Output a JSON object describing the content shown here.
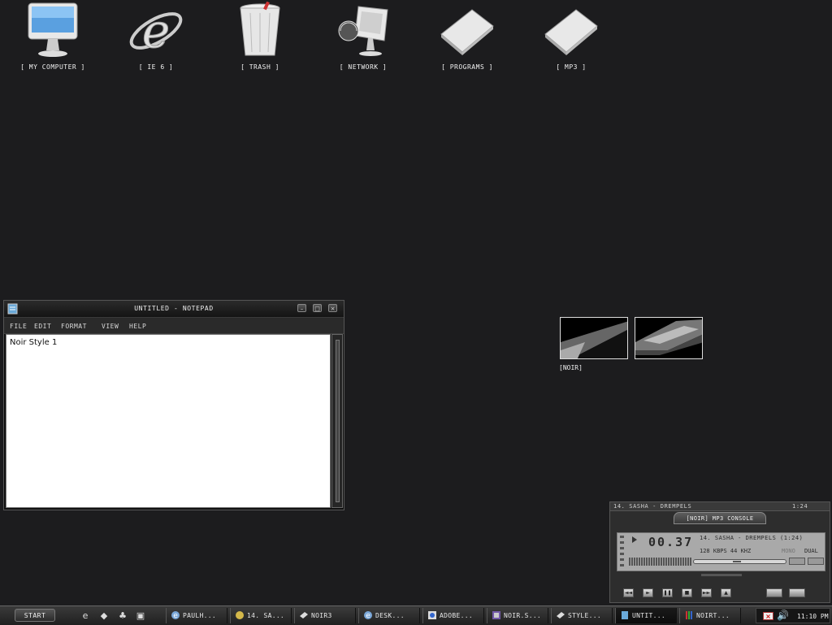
{
  "desktop": {
    "icons": [
      {
        "label": "[ MY COMPUTER ]",
        "icon": "imac-icon"
      },
      {
        "label": "[ IE 6 ]",
        "icon": "internet-explorer-icon"
      },
      {
        "label": "[ TRASH ]",
        "icon": "trash-icon"
      },
      {
        "label": "[ NETWORK ]",
        "icon": "network-icon"
      },
      {
        "label": "[ PROGRAMS ]",
        "icon": "folder-icon"
      },
      {
        "label": "[ MP3 ]",
        "icon": "folder-icon"
      }
    ],
    "thumbnails_label": "[NOIR]"
  },
  "notepad": {
    "title": "UNTITLED - NOTEPAD",
    "menu": [
      "FILE",
      "EDIT",
      "FORMAT",
      "VIEW",
      "HELP"
    ],
    "content": "Noir Style 1",
    "buttons": {
      "minimize": "–",
      "maximize": "□",
      "close": "×"
    }
  },
  "mp3": {
    "top_track": "14. SASHA - DREMPELS",
    "top_time": "1:24",
    "title": "[NOIR] MP3 CONSOLE",
    "time": "00.37",
    "track": "14. SASHA - DREMPELS (1:24)",
    "bitrate": "128 KBPS  44 KHZ",
    "mono": "MONO",
    "dual": "DUAL",
    "controls": [
      "prev-icon",
      "play-icon",
      "pause-icon",
      "stop-icon",
      "next-icon",
      "eject-icon"
    ]
  },
  "taskbar": {
    "start": "START",
    "quick_launch": [
      "internet-explorer-icon",
      "folder-icon",
      "network-icon",
      "monitor-icon"
    ],
    "tasks": [
      {
        "label": "PAULH...",
        "icon": "internet-explorer-icon",
        "active": false
      },
      {
        "label": "14. SA...",
        "icon": "player-icon",
        "active": false
      },
      {
        "label": "NOIR3",
        "icon": "folder-icon",
        "active": false
      },
      {
        "label": "DESK...",
        "icon": "internet-explorer-icon",
        "active": false
      },
      {
        "label": "ADOBE...",
        "icon": "adobe-icon",
        "active": false
      },
      {
        "label": "NOIR.S...",
        "icon": "image-icon",
        "active": false
      },
      {
        "label": "STYLE...",
        "icon": "folder-icon",
        "active": false
      },
      {
        "label": "UNTIT...",
        "icon": "notepad-icon",
        "active": true
      },
      {
        "label": "NOIRT...",
        "icon": "paint-icon",
        "active": false
      }
    ],
    "clock": "11:10 PM"
  },
  "colors": {
    "desktop_bg": "#1c1c1e",
    "window_bg": "#101010",
    "lcd_bg": "#a9a9a9"
  }
}
